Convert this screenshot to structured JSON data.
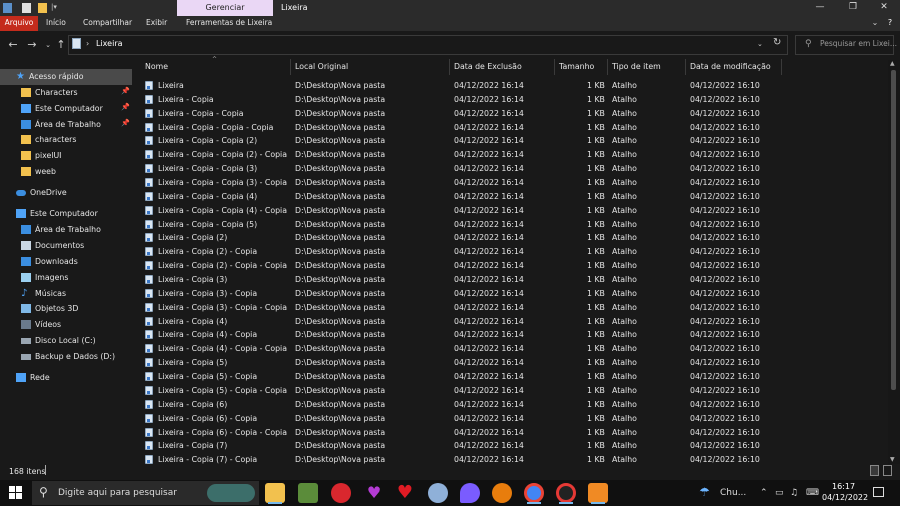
{
  "window": {
    "title": "Lixeira",
    "contextual_tab_group": "Gerenciar",
    "controls": {
      "minimize": "—",
      "maximize": "❐",
      "close": "✕"
    }
  },
  "ribbon": {
    "tabs": [
      "Arquivo",
      "Início",
      "Compartilhar",
      "Exibir",
      "Ferramentas de Lixeira"
    ],
    "active_tab": "Arquivo",
    "accent_color": "#c42b1c"
  },
  "address": {
    "path": "Lixeira",
    "search_placeholder": "Pesquisar em Lixei..."
  },
  "nav": {
    "quick_access": {
      "label": "Acesso rápido",
      "items": [
        {
          "label": "Characters",
          "icon": "folder-icon",
          "pinned": true
        },
        {
          "label": "Este Computador",
          "icon": "computer-icon",
          "pinned": true
        },
        {
          "label": "Área de Trabalho",
          "icon": "desktop-icon",
          "pinned": true
        },
        {
          "label": "characters",
          "icon": "folder-icon",
          "pinned": false
        },
        {
          "label": "pixelUI",
          "icon": "folder-icon",
          "pinned": false
        },
        {
          "label": "weeb",
          "icon": "folder-icon",
          "pinned": false
        }
      ]
    },
    "onedrive": "OneDrive",
    "this_pc": {
      "label": "Este Computador",
      "items": [
        {
          "label": "Área de Trabalho",
          "icon": "desktop-icon"
        },
        {
          "label": "Documentos",
          "icon": "documents-icon"
        },
        {
          "label": "Downloads",
          "icon": "downloads-icon"
        },
        {
          "label": "Imagens",
          "icon": "pictures-icon"
        },
        {
          "label": "Músicas",
          "icon": "music-icon"
        },
        {
          "label": "Objetos 3D",
          "icon": "objects3d-icon"
        },
        {
          "label": "Vídeos",
          "icon": "videos-icon"
        },
        {
          "label": "Disco Local (C:)",
          "icon": "drive-icon"
        },
        {
          "label": "Backup e Dados (D:)",
          "icon": "drive-icon"
        }
      ]
    },
    "network": "Rede"
  },
  "columns": [
    "Nome",
    "Local Original",
    "Data de Exclusão",
    "Tamanho",
    "Tipo de item",
    "Data de modificação"
  ],
  "files": [
    {
      "name": "Lixeira",
      "original": "D:\\Desktop\\Nova pasta",
      "deleted": "04/12/2022 16:14",
      "size": "1 KB",
      "type": "Atalho",
      "modified": "04/12/2022 16:10"
    },
    {
      "name": "Lixeira - Copia",
      "original": "D:\\Desktop\\Nova pasta",
      "deleted": "04/12/2022 16:14",
      "size": "1 KB",
      "type": "Atalho",
      "modified": "04/12/2022 16:10"
    },
    {
      "name": "Lixeira - Copia - Copia",
      "original": "D:\\Desktop\\Nova pasta",
      "deleted": "04/12/2022 16:14",
      "size": "1 KB",
      "type": "Atalho",
      "modified": "04/12/2022 16:10"
    },
    {
      "name": "Lixeira - Copia - Copia - Copia",
      "original": "D:\\Desktop\\Nova pasta",
      "deleted": "04/12/2022 16:14",
      "size": "1 KB",
      "type": "Atalho",
      "modified": "04/12/2022 16:10"
    },
    {
      "name": "Lixeira - Copia - Copia (2)",
      "original": "D:\\Desktop\\Nova pasta",
      "deleted": "04/12/2022 16:14",
      "size": "1 KB",
      "type": "Atalho",
      "modified": "04/12/2022 16:10"
    },
    {
      "name": "Lixeira - Copia - Copia (2) - Copia",
      "original": "D:\\Desktop\\Nova pasta",
      "deleted": "04/12/2022 16:14",
      "size": "1 KB",
      "type": "Atalho",
      "modified": "04/12/2022 16:10"
    },
    {
      "name": "Lixeira - Copia - Copia (3)",
      "original": "D:\\Desktop\\Nova pasta",
      "deleted": "04/12/2022 16:14",
      "size": "1 KB",
      "type": "Atalho",
      "modified": "04/12/2022 16:10"
    },
    {
      "name": "Lixeira - Copia - Copia (3) - Copia",
      "original": "D:\\Desktop\\Nova pasta",
      "deleted": "04/12/2022 16:14",
      "size": "1 KB",
      "type": "Atalho",
      "modified": "04/12/2022 16:10"
    },
    {
      "name": "Lixeira - Copia - Copia (4)",
      "original": "D:\\Desktop\\Nova pasta",
      "deleted": "04/12/2022 16:14",
      "size": "1 KB",
      "type": "Atalho",
      "modified": "04/12/2022 16:10"
    },
    {
      "name": "Lixeira - Copia - Copia (4) - Copia",
      "original": "D:\\Desktop\\Nova pasta",
      "deleted": "04/12/2022 16:14",
      "size": "1 KB",
      "type": "Atalho",
      "modified": "04/12/2022 16:10"
    },
    {
      "name": "Lixeira - Copia - Copia (5)",
      "original": "D:\\Desktop\\Nova pasta",
      "deleted": "04/12/2022 16:14",
      "size": "1 KB",
      "type": "Atalho",
      "modified": "04/12/2022 16:10"
    },
    {
      "name": "Lixeira - Copia (2)",
      "original": "D:\\Desktop\\Nova pasta",
      "deleted": "04/12/2022 16:14",
      "size": "1 KB",
      "type": "Atalho",
      "modified": "04/12/2022 16:10"
    },
    {
      "name": "Lixeira - Copia (2) - Copia",
      "original": "D:\\Desktop\\Nova pasta",
      "deleted": "04/12/2022 16:14",
      "size": "1 KB",
      "type": "Atalho",
      "modified": "04/12/2022 16:10"
    },
    {
      "name": "Lixeira - Copia (2) - Copia - Copia",
      "original": "D:\\Desktop\\Nova pasta",
      "deleted": "04/12/2022 16:14",
      "size": "1 KB",
      "type": "Atalho",
      "modified": "04/12/2022 16:10"
    },
    {
      "name": "Lixeira - Copia (3)",
      "original": "D:\\Desktop\\Nova pasta",
      "deleted": "04/12/2022 16:14",
      "size": "1 KB",
      "type": "Atalho",
      "modified": "04/12/2022 16:10"
    },
    {
      "name": "Lixeira - Copia (3) - Copia",
      "original": "D:\\Desktop\\Nova pasta",
      "deleted": "04/12/2022 16:14",
      "size": "1 KB",
      "type": "Atalho",
      "modified": "04/12/2022 16:10"
    },
    {
      "name": "Lixeira - Copia (3) - Copia - Copia",
      "original": "D:\\Desktop\\Nova pasta",
      "deleted": "04/12/2022 16:14",
      "size": "1 KB",
      "type": "Atalho",
      "modified": "04/12/2022 16:10"
    },
    {
      "name": "Lixeira - Copia (4)",
      "original": "D:\\Desktop\\Nova pasta",
      "deleted": "04/12/2022 16:14",
      "size": "1 KB",
      "type": "Atalho",
      "modified": "04/12/2022 16:10"
    },
    {
      "name": "Lixeira - Copia (4) - Copia",
      "original": "D:\\Desktop\\Nova pasta",
      "deleted": "04/12/2022 16:14",
      "size": "1 KB",
      "type": "Atalho",
      "modified": "04/12/2022 16:10"
    },
    {
      "name": "Lixeira - Copia (4) - Copia - Copia",
      "original": "D:\\Desktop\\Nova pasta",
      "deleted": "04/12/2022 16:14",
      "size": "1 KB",
      "type": "Atalho",
      "modified": "04/12/2022 16:10"
    },
    {
      "name": "Lixeira - Copia (5)",
      "original": "D:\\Desktop\\Nova pasta",
      "deleted": "04/12/2022 16:14",
      "size": "1 KB",
      "type": "Atalho",
      "modified": "04/12/2022 16:10"
    },
    {
      "name": "Lixeira - Copia (5) - Copia",
      "original": "D:\\Desktop\\Nova pasta",
      "deleted": "04/12/2022 16:14",
      "size": "1 KB",
      "type": "Atalho",
      "modified": "04/12/2022 16:10"
    },
    {
      "name": "Lixeira - Copia (5) - Copia - Copia",
      "original": "D:\\Desktop\\Nova pasta",
      "deleted": "04/12/2022 16:14",
      "size": "1 KB",
      "type": "Atalho",
      "modified": "04/12/2022 16:10"
    },
    {
      "name": "Lixeira - Copia (6)",
      "original": "D:\\Desktop\\Nova pasta",
      "deleted": "04/12/2022 16:14",
      "size": "1 KB",
      "type": "Atalho",
      "modified": "04/12/2022 16:10"
    },
    {
      "name": "Lixeira - Copia (6) - Copia",
      "original": "D:\\Desktop\\Nova pasta",
      "deleted": "04/12/2022 16:14",
      "size": "1 KB",
      "type": "Atalho",
      "modified": "04/12/2022 16:10"
    },
    {
      "name": "Lixeira - Copia (6) - Copia - Copia",
      "original": "D:\\Desktop\\Nova pasta",
      "deleted": "04/12/2022 16:14",
      "size": "1 KB",
      "type": "Atalho",
      "modified": "04/12/2022 16:10"
    },
    {
      "name": "Lixeira - Copia (7)",
      "original": "D:\\Desktop\\Nova pasta",
      "deleted": "04/12/2022 16:14",
      "size": "1 KB",
      "type": "Atalho",
      "modified": "04/12/2022 16:10"
    },
    {
      "name": "Lixeira - Copia (7) - Copia",
      "original": "D:\\Desktop\\Nova pasta",
      "deleted": "04/12/2022 16:14",
      "size": "1 KB",
      "type": "Atalho",
      "modified": "04/12/2022 16:10"
    }
  ],
  "status": {
    "item_count": "168 itens"
  },
  "taskbar": {
    "search_placeholder": "Digite aqui para pesquisar",
    "apps": [
      {
        "icon": "file-explorer-icon",
        "color": "#f2c14e"
      },
      {
        "icon": "minecraft-icon",
        "color": "#5b8c3a"
      },
      {
        "icon": "red-app-icon",
        "color": "#d9272e"
      },
      {
        "icon": "purple-heart-app-icon",
        "color": "#b43bd4"
      },
      {
        "icon": "heart-app-icon",
        "color": "#e01b24"
      },
      {
        "icon": "paint-icon",
        "color": "#8fb0d8"
      },
      {
        "icon": "drop-app-icon",
        "color": "#7a5cff"
      },
      {
        "icon": "blender-icon",
        "color": "#e87d0d"
      },
      {
        "icon": "chrome-icon",
        "color": "#4285f4"
      },
      {
        "icon": "record-app-icon",
        "color": "#e53935"
      },
      {
        "icon": "fl-studio-icon",
        "color": "#f08a24"
      }
    ],
    "weather": "Chu...",
    "time": "16:17",
    "date": "04/12/2022"
  }
}
